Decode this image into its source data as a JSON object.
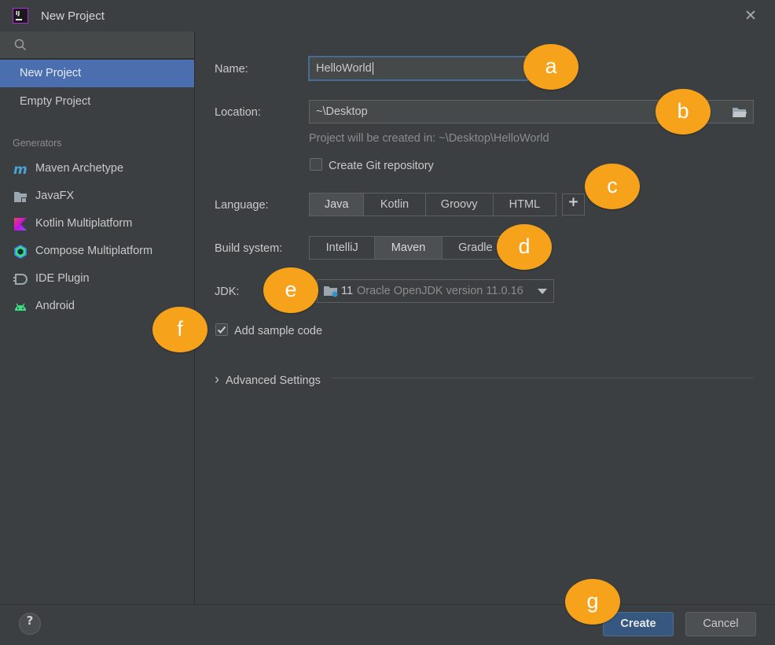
{
  "window": {
    "title": "New Project",
    "close_glyph": "✕"
  },
  "sidebar": {
    "search_placeholder": "",
    "items": [
      {
        "label": "New Project",
        "selected": true
      },
      {
        "label": "Empty Project",
        "selected": false
      }
    ],
    "generators_header": "Generators",
    "generators": [
      {
        "label": "Maven Archetype",
        "icon": "maven-icon"
      },
      {
        "label": "JavaFX",
        "icon": "javafx-icon"
      },
      {
        "label": "Kotlin Multiplatform",
        "icon": "kotlin-icon"
      },
      {
        "label": "Compose Multiplatform",
        "icon": "compose-icon"
      },
      {
        "label": "IDE Plugin",
        "icon": "plugin-icon"
      },
      {
        "label": "Android",
        "icon": "android-icon"
      }
    ]
  },
  "form": {
    "name_label": "Name:",
    "name_value": "HelloWorld",
    "location_label": "Location:",
    "location_value": "~\\Desktop",
    "location_hint": "Project will be created in: ~\\Desktop\\HelloWorld",
    "git_label": "Create Git repository",
    "git_checked": false,
    "language_label": "Language:",
    "languages": [
      "Java",
      "Kotlin",
      "Groovy",
      "HTML"
    ],
    "language_selected": "Java",
    "plus_label": "+",
    "build_label": "Build system:",
    "build_systems": [
      "IntelliJ",
      "Maven",
      "Gradle"
    ],
    "build_selected": "Maven",
    "jdk_label": "JDK:",
    "jdk_version": "11",
    "jdk_description": "Oracle OpenJDK version 11.0.16",
    "sample_label": "Add sample code",
    "sample_checked": true,
    "advanced_label": "Advanced Settings",
    "advanced_glyph": "›"
  },
  "footer": {
    "help_label": "?",
    "create_label": "Create",
    "cancel_label": "Cancel"
  },
  "markers": {
    "a": "a",
    "b": "b",
    "c": "c",
    "d": "d",
    "e": "e",
    "f": "f",
    "g": "g"
  },
  "colors": {
    "accent": "#4b6eaf",
    "marker": "#f7a21b",
    "primary_button": "#365880",
    "background": "#3c3f41"
  }
}
